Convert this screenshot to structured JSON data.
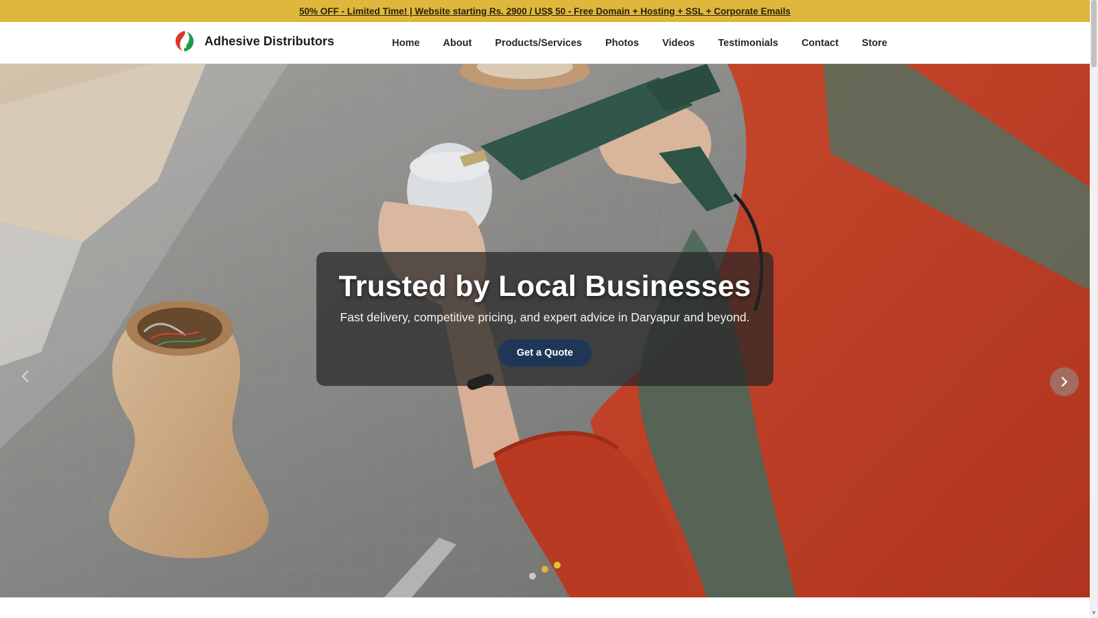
{
  "promo": {
    "text": "50% OFF - Limited Time! | Website starting Rs. 2900 / US$ 50 - Free Domain + Hosting + SSL + Corporate Emails",
    "background": "#dfb73c"
  },
  "header": {
    "brand_name": "Adhesive Distributors",
    "logo_icon": "leaf-logo-icon",
    "logo_colors": [
      "#d83a2c",
      "#1f9a4a"
    ],
    "nav": {
      "home": "Home",
      "about": "About",
      "products": "Products/Services",
      "photos": "Photos",
      "videos": "Videos",
      "testimonials": "Testimonials",
      "contact": "Contact",
      "store": "Store"
    }
  },
  "hero": {
    "title": "Trusted by Local Businesses",
    "subtitle": "Fast delivery, competitive pricing, and expert advice in Daryapur and beyond.",
    "cta_label": "Get a Quote",
    "cta_color": "#1e3756",
    "prev_icon": "chevron-left-icon",
    "next_icon": "chevron-right-icon",
    "slides_count": 3,
    "active_slide": 2
  }
}
